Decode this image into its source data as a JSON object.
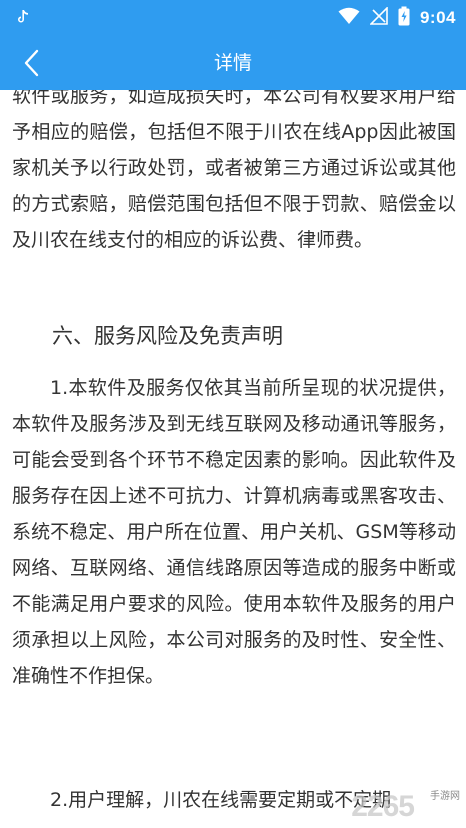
{
  "status_bar": {
    "time": "9:04",
    "icons": [
      "tiktok-icon",
      "wifi-icon",
      "signal-icon",
      "battery-icon"
    ]
  },
  "app_bar": {
    "title": "详情",
    "back_icon": "chevron-left-icon"
  },
  "article": {
    "paragraph_1": "软件或服务，如造成损失时，本公司有权要求用户给予相应的赔偿，包括但不限于川农在线App因此被国家机关予以行政处罚，或者被第三方通过诉讼或其他的方式索赔，赔偿范围包括但不限于罚款、赔偿金以及川农在线支付的相应的诉讼费、律师费。",
    "section_heading": "六、服务风险及免责声明",
    "paragraph_2": "1.本软件及服务仅依其当前所呈现的状况提供，本软件及服务涉及到无线互联网及移动通讯等服务，可能会受到各个环节不稳定因素的影响。因此软件及服务存在因上述不可抗力、计算机病毒或黑客攻击、系统不稳定、用户所在位置、用户关机、GSM等移动网络、互联网络、通信线路原因等造成的服务中断或不能满足用户要求的风险。使用本软件及服务的用户须承担以上风险，本公司对服务的及时性、安全性、准确性不作担保。",
    "paragraph_3": "2.用户理解，川农在线需要定期或不定期"
  },
  "watermark": {
    "brand": "2265",
    "label": "手游网"
  },
  "colors": {
    "primary": "#2f9cf0",
    "text": "#333333",
    "background": "#ffffff"
  }
}
